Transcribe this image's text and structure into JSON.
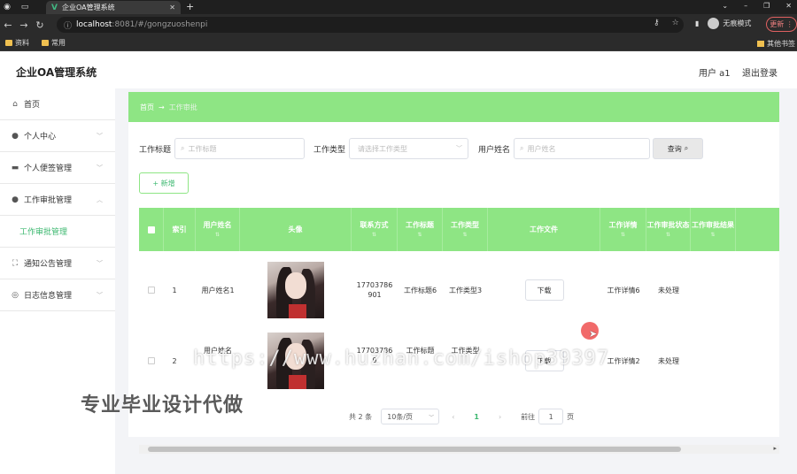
{
  "browser": {
    "tab_title": "企业OA管理系统",
    "tab_logo": "V",
    "url_host": "localhost",
    "url_path": ":8081/#/gongzuoshenpi",
    "profile_label": "无痕模式",
    "update_label": "更新",
    "bookmarks": [
      "资料",
      "常用"
    ],
    "bookmark_right": "其他书签"
  },
  "header": {
    "title": "企业OA管理系统",
    "user": "用户 a1",
    "logout": "退出登录"
  },
  "sidebar": {
    "items": [
      {
        "label": "首页",
        "icon": "home-icon"
      },
      {
        "label": "个人中心",
        "icon": "user-icon"
      },
      {
        "label": "个人便签管理",
        "icon": "briefcase-icon"
      },
      {
        "label": "工作审批管理",
        "icon": "user-icon"
      },
      {
        "label": "通知公告管理",
        "icon": "fullscreen-icon"
      },
      {
        "label": "日志信息管理",
        "icon": "compass-icon"
      }
    ],
    "active_sub": "工作审批管理"
  },
  "breadcrumb": {
    "home": "首页",
    "sep": "→",
    "current": "工作审批"
  },
  "filters": {
    "title_label": "工作标题",
    "title_placeholder": "工作标题",
    "type_label": "工作类型",
    "type_placeholder": "请选择工作类型",
    "user_label": "用户姓名",
    "user_placeholder": "用户姓名",
    "query_label": "查询"
  },
  "add_label": "+ 新增",
  "table": {
    "headers": [
      "",
      "索引",
      "用户姓名",
      "头像",
      "联系方式",
      "工作标题",
      "工作类型",
      "工作文件",
      "工作详情",
      "工作审批状态",
      "工作审批结果"
    ],
    "download_label": "下载",
    "rows": [
      {
        "index": "1",
        "user": "用户姓名1",
        "phone": "17703786901",
        "title": "工作标题6",
        "type": "工作类型3",
        "detail": "工作详情6",
        "status": "未处理"
      },
      {
        "index": "2",
        "user": "用户姓名",
        "phone": "177037869",
        "title": "工作标题",
        "type": "工作类型",
        "detail": "工作详情2",
        "status": "未处理"
      }
    ]
  },
  "pager": {
    "total": "共 2 条",
    "size": "10条/页",
    "prev": "‹",
    "page": "1",
    "next": "›",
    "goto": "前往",
    "goto_value": "1",
    "page_unit": "页"
  },
  "watermark": {
    "url": "https://www.huzhan.com/ishop39397",
    "text": "专业毕业设计代做"
  },
  "colors": {
    "accent": "#8ee584",
    "accent_text": "#3db870"
  }
}
